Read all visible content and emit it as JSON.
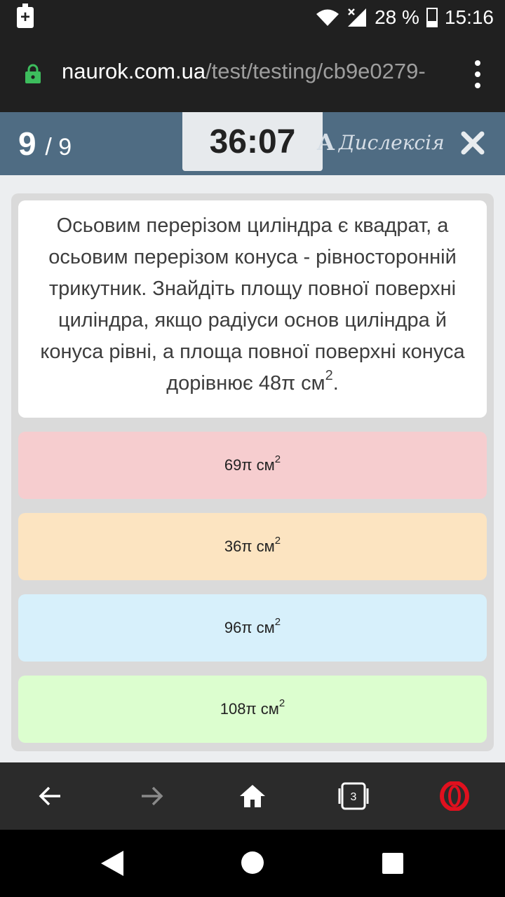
{
  "status_bar": {
    "battery_percent": "28 %",
    "time": "15:16",
    "charge_symbol": "+"
  },
  "browser": {
    "url_domain": "naurok.com.ua",
    "url_path": "/test/testing/cb9e0279-"
  },
  "quiz_header": {
    "current_question": "9",
    "total_questions": "/ 9",
    "timer": "36:07",
    "dyslexia_icon_letter": "A",
    "dyslexia_label": "Дислексія"
  },
  "question": {
    "text": "Осьовим перерізом циліндра є квадрат, а осьовим перерізом конуса - рівносторонній трикутник. Знайдіть площу повної поверхні циліндра, якщо радіуси основ циліндра й конуса рівні, а площа повної поверхні конуса дорівнює 48π см",
    "exponent": "2",
    "end_punct": "."
  },
  "answers": [
    {
      "text": "69π см",
      "exp": "2",
      "color": "#f6cdcf"
    },
    {
      "text": "36π см",
      "exp": "2",
      "color": "#fce4c1"
    },
    {
      "text": "96π см",
      "exp": "2",
      "color": "#d7f0fb"
    },
    {
      "text": "108π см",
      "exp": "2",
      "color": "#dcfecf"
    }
  ],
  "browser_nav": {
    "tabs_count": "3",
    "icons": [
      "back-arrow-icon",
      "forward-arrow-icon",
      "home-icon",
      "tabs-icon",
      "opera-icon"
    ]
  },
  "colors": {
    "quiz_header": "#4f6c83",
    "timer_bg": "#e7eaed",
    "lock": "#3dbd5d",
    "opera": "#e0101e"
  }
}
